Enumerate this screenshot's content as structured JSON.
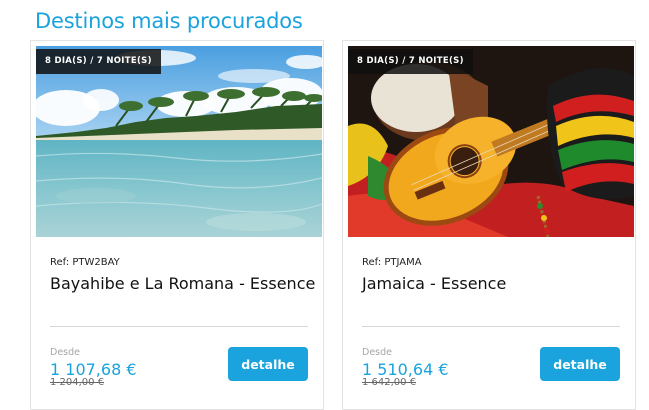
{
  "section": {
    "title": "Destinos mais procurados"
  },
  "cards": [
    {
      "duration": "8 DIA(S) / 7 NOITE(S)",
      "ref": "Ref: PTW2BAY",
      "name": "Bayahibe e La Romana - Essence",
      "from_label": "Desde",
      "price": "1 107,68 €",
      "old_price": "1 204,00 €",
      "button_label": "detalhe",
      "image": "tropical beach with palm trees and turquoise water"
    },
    {
      "duration": "8 DIA(S) / 7 NOITE(S)",
      "ref": "Ref: PTJAMA",
      "name": "Jamaica - Essence",
      "from_label": "Desde",
      "price": "1 510,64 €",
      "old_price": "1 642,00 €",
      "button_label": "detalhe",
      "image": "yellow ukulele, drum and rasta knitted hat"
    }
  ],
  "colors": {
    "accent": "#1aa3dc",
    "badge_bg": "#141414"
  }
}
